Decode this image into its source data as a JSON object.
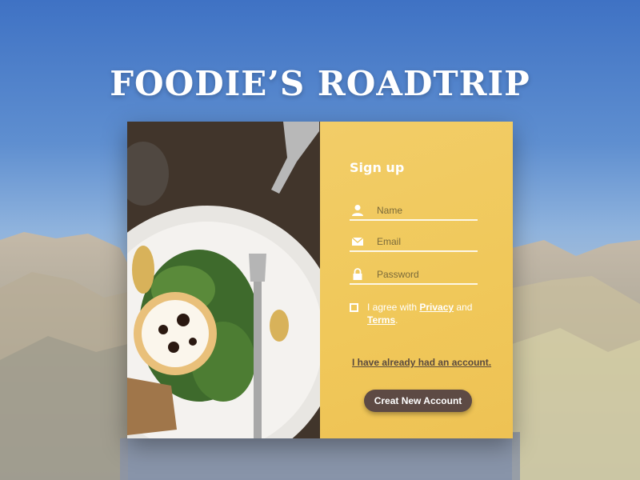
{
  "app": {
    "title": "FOODIE’S ROADTRIP"
  },
  "signup": {
    "title": "Sign up",
    "name_placeholder": "Name",
    "email_placeholder": "Email",
    "password_placeholder": "Password",
    "agree_prefix": "I agree with ",
    "privacy_label": "Privacy",
    "agree_middle": " and ",
    "terms_label": "Terms",
    "agree_suffix": ".",
    "have_account_label": "I have already had an account.",
    "create_button_label": "Creat New Account"
  },
  "icons": {
    "name": "user-icon",
    "email": "envelope-icon",
    "password": "lock-icon",
    "checkbox": "checkbox-icon"
  },
  "colors": {
    "panel": "#f0c85a",
    "button": "#5d4a44",
    "title_text": "#ffffff",
    "link_dark": "#5a4a3e"
  }
}
